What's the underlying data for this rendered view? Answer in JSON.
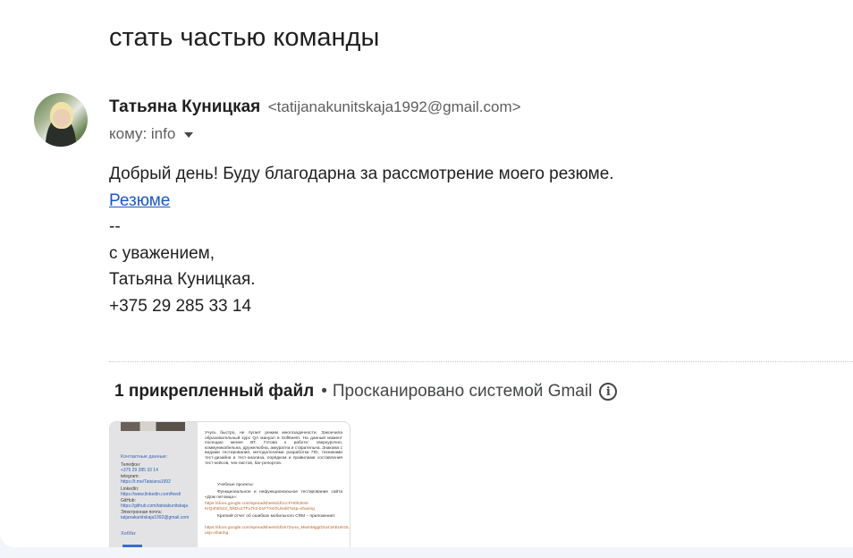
{
  "email": {
    "subject": "стать частью команды",
    "sender_name": "Татьяна Куницкая",
    "sender_email": "<tatijanakunitskaja1992@gmail.com>",
    "to_label": "кому: info",
    "body": {
      "greeting": "Добрый день! Буду благодарна за рассмотрение моего резюме.",
      "link_text": "Резюме",
      "signature_sep": "--",
      "regards": "с уважением,",
      "name": "Татьяна Куницкая.",
      "phone": "+375 29 285 33 14"
    }
  },
  "attachments": {
    "count_label": "1 прикрепленный файл",
    "separator": "•",
    "scan_label": "Просканировано системой Gmail",
    "info_icon": "info-icon",
    "thumbnail": {
      "left": {
        "contacts_heading": "Контактные данные:",
        "phone_label": "Телефон:",
        "phone": "+375 29 285 33 14",
        "telegram_label": "telegram:",
        "telegram": "https://t.me/Tatsiana1992",
        "linkedin_label": "LinkedIn:",
        "linkedin": "https://www.linkedin.com/feed/",
        "github_label": "GitHub:",
        "github": "https://github.com/tatsiakunitskaja",
        "email_label": "Электронная почта:",
        "email": "tatjanakunitskaja1992@gmail.com",
        "hobbies": "Хобби:"
      },
      "right": {
        "para1": "Учусь быстро, не пугает режим многозадачности. Закончила образовательный курс QA мануал в Softkeetri. На данный момент посещаю менее ВТ. Готова к работе: сверхурочно, коммуникабельна, дружелюбна, аккуратна и старательна. Знакома с видами тестирования, методологиями разработки ПО, техниками тест-дизайна и тест-анализа, порядком и правилами составления тест-кейсов, чек-листов, баг-репортов.",
        "projects_heading": "Учебные проекты:",
        "project1": "Функциональное и нефункциональное тестирование сайта «Дом питомца»:",
        "project1_link": "https://docs.google.com/spreadsheets/d/1ccFH0h2K6i-KrQ4hE5z3_f2kDu1TFuTk2-01F7X4OU/edit?usp=sharing",
        "project2": "Краткий отчет об ошибках мобильного CRM – приложения:",
        "project2_link": "https://docs.google.com/spreadsheets/d/1k7Zuna_MwmMgg03U41KEUKGLrzrHUkpx05RBBz/edit?usp=sharing"
      }
    }
  }
}
